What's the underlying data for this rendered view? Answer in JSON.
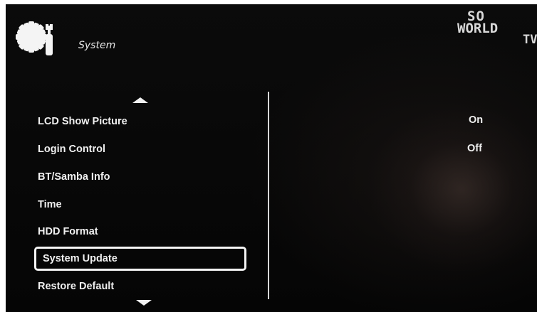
{
  "header": {
    "title": "System",
    "icon": "gear-wrench-icon"
  },
  "logo": {
    "line1": "SO",
    "line2": "WORLD",
    "line3": "TV"
  },
  "menu": {
    "items": [
      {
        "label": "LCD Show Picture",
        "value": "On"
      },
      {
        "label": "Login Control",
        "value": "Off"
      },
      {
        "label": "BT/Samba Info",
        "value": ""
      },
      {
        "label": "Time",
        "value": ""
      },
      {
        "label": "HDD Format",
        "value": ""
      },
      {
        "label": "System Update",
        "value": "",
        "selected": true
      },
      {
        "label": "Restore Default",
        "value": ""
      }
    ],
    "scroll_up_icon": "triangle-up-icon",
    "scroll_down_icon": "triangle-down-icon"
  },
  "colors": {
    "background": "#050505",
    "text": "#f0f0f0",
    "highlight_border": "#f4f4f4"
  }
}
